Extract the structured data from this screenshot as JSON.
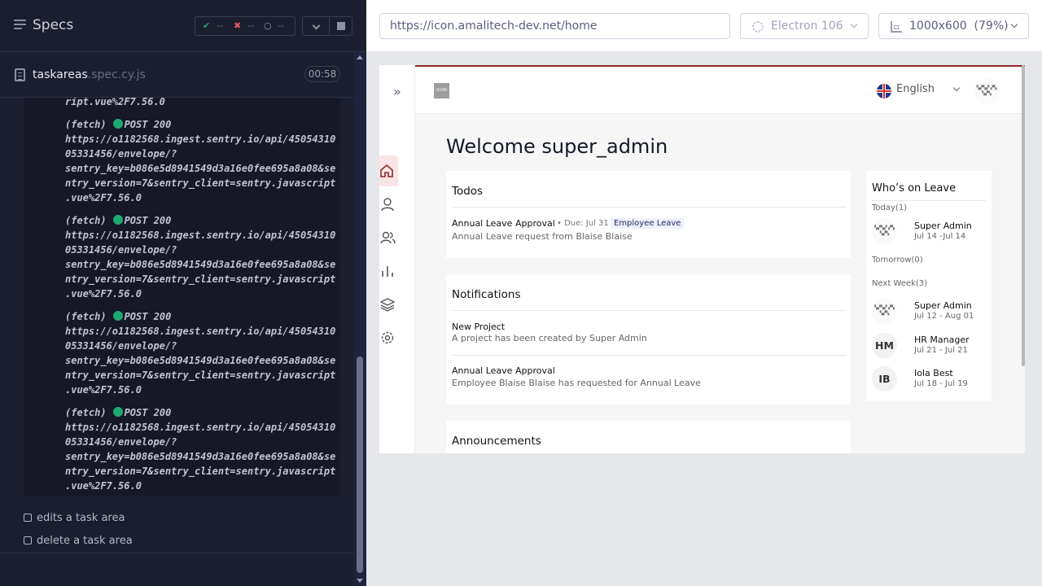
{
  "runner": {
    "specs_title": "Specs",
    "stats": {
      "passed": "--",
      "failed": "--",
      "pending": "--"
    },
    "spec_file": {
      "name": "taskareas",
      "ext": ".spec.cy.js",
      "duration": "00:58"
    },
    "log_fragment": "ript.vue%2F7.56.0",
    "log_entries": [
      {
        "type": "(fetch)",
        "method": "POST 200",
        "url_lines": [
          "https://o1182568.ingest.sentry.io/api/45054310",
          "05331456/envelope/?",
          "sentry_key=b086e5d8941549d3a16e0fee695a8a08&se",
          "ntry_version=7&sentry_client=sentry.javascript",
          ".vue%2F7.56.0"
        ]
      },
      {
        "type": "(fetch)",
        "method": "POST 200",
        "url_lines": [
          "https://o1182568.ingest.sentry.io/api/45054310",
          "05331456/envelope/?",
          "sentry_key=b086e5d8941549d3a16e0fee695a8a08&se",
          "ntry_version=7&sentry_client=sentry.javascript",
          ".vue%2F7.56.0"
        ]
      },
      {
        "type": "(fetch)",
        "method": "POST 200",
        "url_lines": [
          "https://o1182568.ingest.sentry.io/api/45054310",
          "05331456/envelope/?",
          "sentry_key=b086e5d8941549d3a16e0fee695a8a08&se",
          "ntry_version=7&sentry_client=sentry.javascript",
          ".vue%2F7.56.0"
        ]
      },
      {
        "type": "(fetch)",
        "method": "POST 200",
        "url_lines": [
          "https://o1182568.ingest.sentry.io/api/45054310",
          "05331456/envelope/?",
          "sentry_key=b086e5d8941549d3a16e0fee695a8a08&se",
          "ntry_version=7&sentry_client=sentry.javascript",
          ".vue%2F7.56.0"
        ]
      }
    ],
    "tests": [
      "edits a task area",
      "delete a task area"
    ]
  },
  "toolbar": {
    "url": "https://icon.amalitech-dev.net/home",
    "browser": "Electron 106",
    "viewport": "1000x600  (79%)"
  },
  "app": {
    "logo_text": "ICON",
    "language": "English",
    "welcome": "Welcome super_admin",
    "todos": {
      "title": "Todos",
      "items": [
        {
          "title": "Annual Leave Approval",
          "due": "• Due: Jul 31",
          "tag": "Employee Leave",
          "desc": "Annual Leave request from Blaise Blaise"
        }
      ]
    },
    "notifications": {
      "title": "Notifications",
      "items": [
        {
          "title": "New Project",
          "desc": "A project has been created by Super Admin"
        },
        {
          "title": "Annual Leave Approval",
          "desc": "Employee Blaise Blaise has requested for Annual Leave"
        }
      ]
    },
    "announcements": {
      "title": "Announcements"
    },
    "leave": {
      "title": "Who’s on Leave",
      "today_label": "Today(1)",
      "tomorrow_label": "Tomorrow(0)",
      "next_week_label": "Next Week(3)",
      "today": [
        {
          "name": "Super Admin",
          "dates": "Jul 14 -Jul 14"
        }
      ],
      "next_week": [
        {
          "initials": "",
          "name": "Super Admin",
          "dates": "Jul 12 - Aug 01"
        },
        {
          "initials": "HM",
          "name": "HR Manager",
          "dates": "Jul 21 - Jul 21"
        },
        {
          "initials": "IB",
          "name": "Iola Best",
          "dates": "Jul 18 - Jul 19"
        }
      ]
    }
  },
  "colors": {
    "runner_bg": "#1b1e2e",
    "pass": "#1fa971",
    "fail": "#e45770",
    "app_accent": "#8a2a2b",
    "nav_active_bg": "#fbe4e6"
  },
  "icons": [
    "specs-menu-icon",
    "check-icon",
    "x-icon",
    "spinner-icon",
    "chevron-down-icon",
    "stop-icon",
    "file-icon",
    "gear-icon",
    "viewport-icon",
    "expand-icon",
    "home-icon",
    "user-icon",
    "users-icon",
    "chart-icon",
    "layers-icon",
    "settings-icon",
    "flag-uk-icon"
  ]
}
